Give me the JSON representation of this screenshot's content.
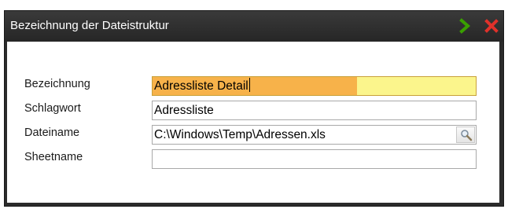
{
  "window": {
    "title": "Bezeichnung der Dateistruktur",
    "ok_icon": "chevron-right-icon",
    "close_icon": "close-icon",
    "ok_color": "#3aa000",
    "close_color": "#e0312a"
  },
  "form": {
    "bezeichnung": {
      "label": "Bezeichnung",
      "value": "Adressliste Detail"
    },
    "schlagwort": {
      "label": "Schlagwort",
      "value": "Adressliste"
    },
    "dateiname": {
      "label": "Dateiname",
      "value": "C:\\Windows\\Temp\\Adressen.xls",
      "browse_icon": "magnifier-icon"
    },
    "sheetname": {
      "label": "Sheetname",
      "value": ""
    }
  },
  "colors": {
    "active_field_selection": "#f7b24a",
    "active_field_background": "#fbf58c"
  }
}
